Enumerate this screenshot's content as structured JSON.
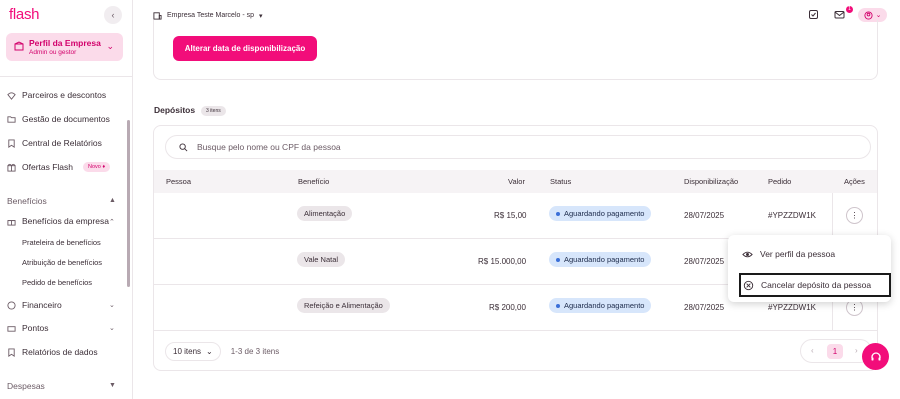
{
  "brand": {
    "logo": "flash",
    "accent": "#f20d7a"
  },
  "sidebar": {
    "profile": {
      "title": "Perfil da Empresa",
      "subtitle": "Admin ou gestor"
    },
    "items": [
      {
        "label": "Parceiros e descontos",
        "icon": "partners-icon"
      },
      {
        "label": "Gestão de documentos",
        "icon": "folder-icon"
      },
      {
        "label": "Central de Relatórios",
        "icon": "report-icon"
      },
      {
        "label": "Ofertas Flash",
        "icon": "offers-icon",
        "badge": "Novo ♦"
      }
    ],
    "beneficios": {
      "section": "Benefícios",
      "group": "Benefícios da empresa",
      "subitems": [
        "Prateleira de benefícios",
        "Atribuição de benefícios",
        "Pedido de benefícios"
      ]
    },
    "more": [
      {
        "label": "Financeiro",
        "icon": "finance-icon"
      },
      {
        "label": "Pontos",
        "icon": "points-icon"
      },
      {
        "label": "Relatórios de dados",
        "icon": "data-report-icon"
      }
    ],
    "despesas": "Despesas"
  },
  "topbar": {
    "company": "Empresa Teste Marcelo - sp",
    "notification_count": "1"
  },
  "main": {
    "change_date_button": "Alterar data de disponibilização",
    "deposits_title": "Depósitos",
    "deposits_count": "3 itens",
    "search_placeholder": "Busque pelo nome ou CPF da pessoa",
    "columns": [
      "Pessoa",
      "Benefício",
      "Valor",
      "Status",
      "Disponibilização",
      "Pedido",
      "Ações"
    ],
    "rows": [
      {
        "pessoa": "",
        "beneficio": "Alimentação",
        "valor": "R$ 15,00",
        "status": "Aguardando pagamento",
        "disponibilizacao": "28/07/2025",
        "pedido": "#YPZZDW1K"
      },
      {
        "pessoa": "",
        "beneficio": "Vale Natal",
        "valor": "R$ 15.000,00",
        "status": "Aguardando pagamento",
        "disponibilizacao": "28/07/2025",
        "pedido": ""
      },
      {
        "pessoa": "",
        "beneficio": "Refeição e Alimentação",
        "valor": "R$ 200,00",
        "status": "Aguardando pagamento",
        "disponibilizacao": "28/07/2025",
        "pedido": "#YPZZDW1K"
      }
    ],
    "pagination": {
      "page_size": "10 itens",
      "range": "1-3 de 3 itens",
      "current_page": "1"
    }
  },
  "context_menu": {
    "items": [
      {
        "label": "Ver perfil da pessoa",
        "icon": "eye-icon"
      },
      {
        "label": "Cancelar depósito da pessoa",
        "icon": "cancel-circle-icon"
      }
    ]
  }
}
